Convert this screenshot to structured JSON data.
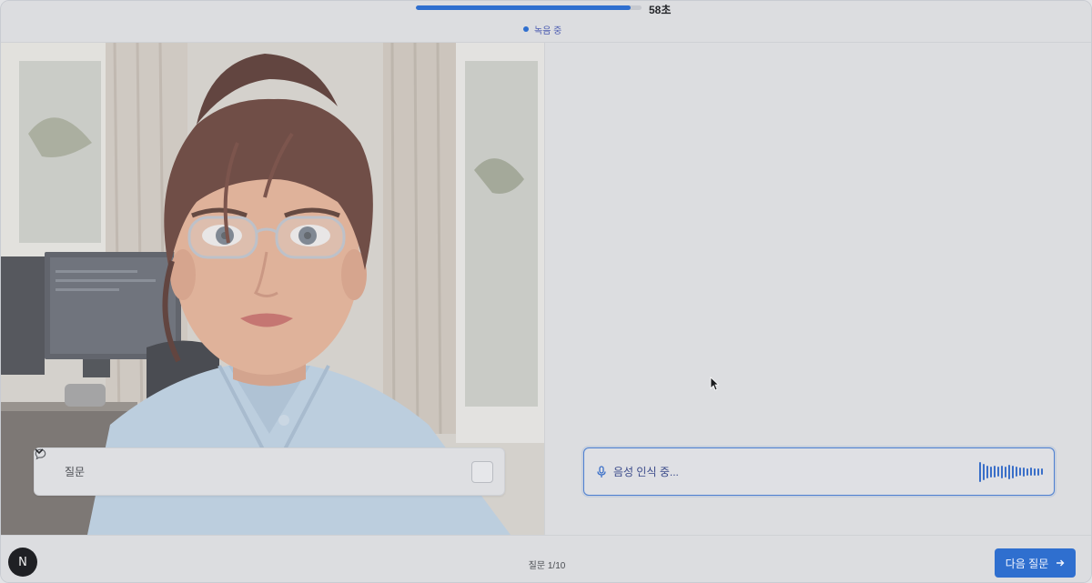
{
  "header": {
    "progress_fraction": 0.95,
    "timer": "58초",
    "status": "녹음 중"
  },
  "avatar_panel": {
    "question_label": "질문"
  },
  "answer_panel": {
    "stt_status": "음성 인식 중..."
  },
  "footer": {
    "badge_letter": "N",
    "question_counter": "질문 1/10",
    "next_button_label": "다음 질문"
  },
  "icons": {
    "question": "chat-bubble-icon",
    "toggle": "chevron-down-icon",
    "mic": "microphone-icon",
    "next": "arrow-right-icon"
  },
  "colors": {
    "accent": "#2f6fcf",
    "waveform": "#3a6fc8",
    "badge_bg": "#1f2024"
  }
}
